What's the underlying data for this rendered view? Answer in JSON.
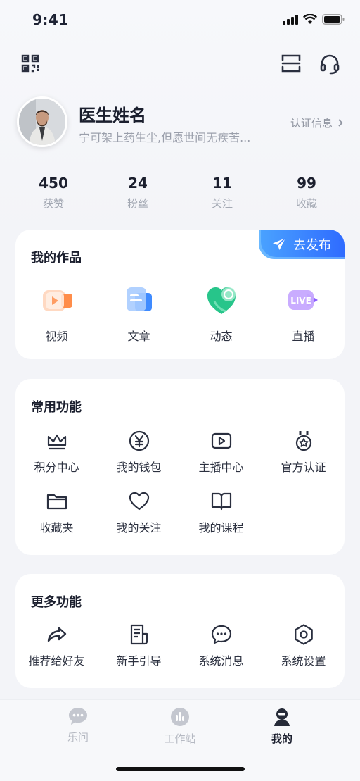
{
  "status": {
    "time": "9:41"
  },
  "profile": {
    "name": "医生姓名",
    "motto": "宁可架上药生尘,但愿世间无疾苦...",
    "cert_label": "认证信息"
  },
  "stats": [
    {
      "value": "450",
      "label": "获赞"
    },
    {
      "value": "24",
      "label": "粉丝"
    },
    {
      "value": "11",
      "label": "关注"
    },
    {
      "value": "99",
      "label": "收藏"
    }
  ],
  "works": {
    "title": "我的作品",
    "publish_label": "去发布",
    "items": [
      {
        "label": "视频",
        "icon": "video-icon"
      },
      {
        "label": "文章",
        "icon": "article-icon"
      },
      {
        "label": "动态",
        "icon": "moments-icon"
      },
      {
        "label": "直播",
        "icon": "live-icon",
        "badge": "LIVE"
      }
    ]
  },
  "common": {
    "title": "常用功能",
    "items": [
      {
        "label": "积分中心",
        "icon": "crown-icon"
      },
      {
        "label": "我的钱包",
        "icon": "yen-coin-icon"
      },
      {
        "label": "主播中心",
        "icon": "play-screen-icon"
      },
      {
        "label": "官方认证",
        "icon": "medal-icon"
      },
      {
        "label": "收藏夹",
        "icon": "folder-icon"
      },
      {
        "label": "我的关注",
        "icon": "heart-icon"
      },
      {
        "label": "我的课程",
        "icon": "book-icon"
      }
    ]
  },
  "more": {
    "title": "更多功能",
    "items": [
      {
        "label": "推荐给好友",
        "icon": "share-icon"
      },
      {
        "label": "新手引导",
        "icon": "guide-doc-icon"
      },
      {
        "label": "系统消息",
        "icon": "message-icon"
      },
      {
        "label": "系统设置",
        "icon": "settings-icon"
      }
    ]
  },
  "tabbar": [
    {
      "label": "乐问",
      "icon": "chat-bubble-icon",
      "active": false
    },
    {
      "label": "工作站",
      "icon": "workstation-icon",
      "active": false
    },
    {
      "label": "我的",
      "icon": "user-icon",
      "active": true
    }
  ],
  "colors": {
    "accent": "#2f6bff",
    "text": "#1b1f2e",
    "muted": "#a3a8b3",
    "inactive_tab": "#b5b9c2"
  }
}
